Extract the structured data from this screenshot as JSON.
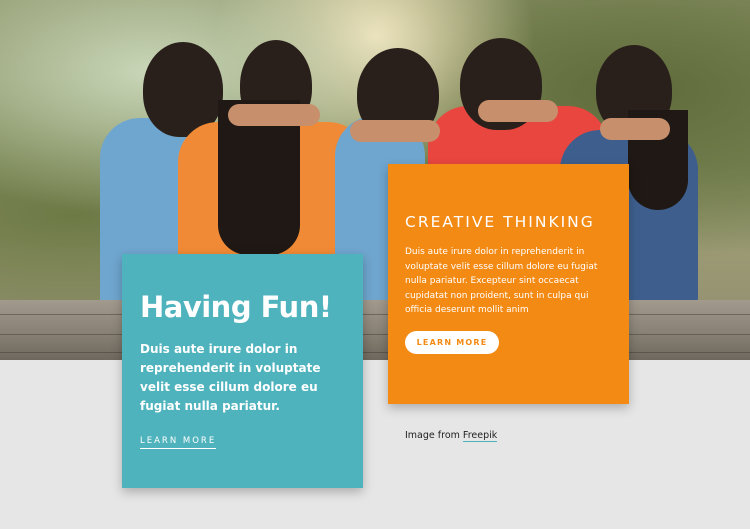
{
  "cards": {
    "fun": {
      "title": "Having Fun!",
      "body": "Duis aute irure dolor in reprehenderit in voluptate velit esse cillum dolore eu fugiat nulla pariatur.",
      "link_label": "LEARN MORE"
    },
    "creative": {
      "title": "CREATIVE THINKING",
      "body": "Duis aute irure dolor in reprehenderit in voluptate velit esse cillum dolore eu fugiat nulla pariatur. Excepteur sint occaecat cupidatat non proident, sunt in culpa qui officia deserunt mollit anim",
      "button_label": "LEARN MORE"
    }
  },
  "credit": {
    "prefix": "Image from",
    "link": "Freepik"
  },
  "colors": {
    "teal": "#4fb3bd",
    "orange": "#f38a14",
    "background": "#e6e6e6"
  }
}
